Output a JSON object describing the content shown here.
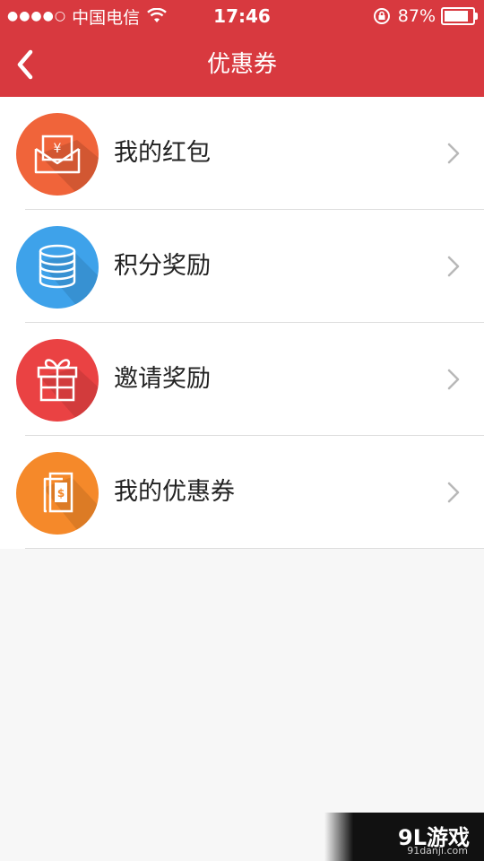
{
  "status_bar": {
    "signal": "●●●●○",
    "carrier": "中国电信",
    "time": "17:46",
    "battery_percent": "87%"
  },
  "nav": {
    "title": "优惠券",
    "back_icon": "chevron-left-icon"
  },
  "items": [
    {
      "label": "我的红包",
      "icon": "red-envelope-icon",
      "color": "#f0643a"
    },
    {
      "label": "积分奖励",
      "icon": "coin-stack-icon",
      "color": "#3ea2ea"
    },
    {
      "label": "邀请奖励",
      "icon": "gift-icon",
      "color": "#ea4243"
    },
    {
      "label": "我的优惠券",
      "icon": "coupon-icon",
      "color": "#f5892a"
    }
  ],
  "watermark": {
    "logo": "9L游戏",
    "url": "91danji.com"
  }
}
